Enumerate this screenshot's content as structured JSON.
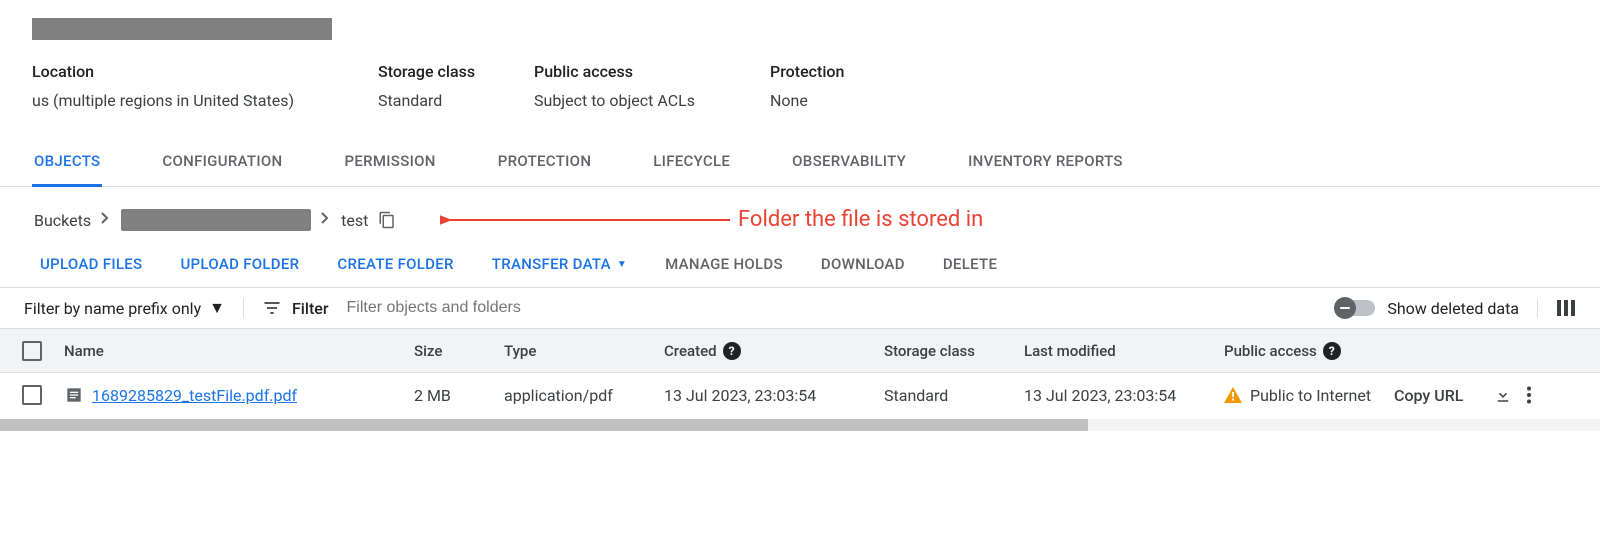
{
  "info": {
    "location_label": "Location",
    "location_value": "us (multiple regions in United States)",
    "storage_class_label": "Storage class",
    "storage_class_value": "Standard",
    "public_access_label": "Public access",
    "public_access_value": "Subject to object ACLs",
    "protection_label": "Protection",
    "protection_value": "None"
  },
  "tabs": {
    "objects": "OBJECTS",
    "configuration": "CONFIGURATION",
    "permission": "PERMISSION",
    "protection": "PROTECTION",
    "lifecycle": "LIFECYCLE",
    "observability": "OBSERVABILITY",
    "inventory_reports": "INVENTORY REPORTS"
  },
  "breadcrumb": {
    "root": "Buckets",
    "folder": "test"
  },
  "annotation": {
    "text": "Folder the file is stored in"
  },
  "actions": {
    "upload_files": "UPLOAD FILES",
    "upload_folder": "UPLOAD FOLDER",
    "create_folder": "CREATE FOLDER",
    "transfer_data": "TRANSFER DATA",
    "manage_holds": "MANAGE HOLDS",
    "download": "DOWNLOAD",
    "delete": "DELETE"
  },
  "filter": {
    "prefix_label": "Filter by name prefix only",
    "filter_word": "Filter",
    "placeholder": "Filter objects and folders",
    "toggle_label": "Show deleted data"
  },
  "table": {
    "headers": {
      "name": "Name",
      "size": "Size",
      "type": "Type",
      "created": "Created",
      "storage_class": "Storage class",
      "last_modified": "Last modified",
      "public_access": "Public access"
    },
    "help_glyph": "?",
    "rows": [
      {
        "name": "1689285829_testFile.pdf.pdf",
        "size": "2 MB",
        "type": "application/pdf",
        "created": "13 Jul 2023, 23:03:54",
        "storage_class": "Standard",
        "last_modified": "13 Jul 2023, 23:03:54",
        "public_access": "Public to Internet",
        "copy_url": "Copy URL"
      }
    ]
  }
}
